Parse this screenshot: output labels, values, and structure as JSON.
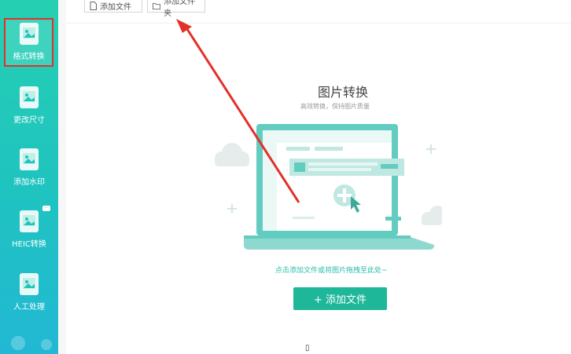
{
  "sidebar": {
    "items": [
      {
        "label": "格式转换",
        "icon": "image-convert-icon",
        "active": true
      },
      {
        "label": "更改尺寸",
        "icon": "image-resize-icon"
      },
      {
        "label": "添加水印",
        "icon": "watermark-icon"
      },
      {
        "label": "HEIC转换",
        "icon": "heic-icon",
        "badge": "···"
      },
      {
        "label": "人工处理",
        "icon": "manual-process-icon"
      }
    ]
  },
  "toolbar": {
    "add_file_label": "添加文件",
    "add_folder_label": "添加文件夹"
  },
  "main": {
    "title": "图片转换",
    "subtitle": "高效转换，保持图片质量",
    "hint": "点击添加文件或将图片拖拽至此处~",
    "add_button_label": "+ 添加文件"
  },
  "colors": {
    "brand": "#1fb79a",
    "sidebar_top": "#25d0b2",
    "sidebar_bottom": "#22b8d4",
    "highlight": "#e3302a",
    "annotation_arrow": "#e3302a"
  },
  "cursor_glyph": "▯"
}
